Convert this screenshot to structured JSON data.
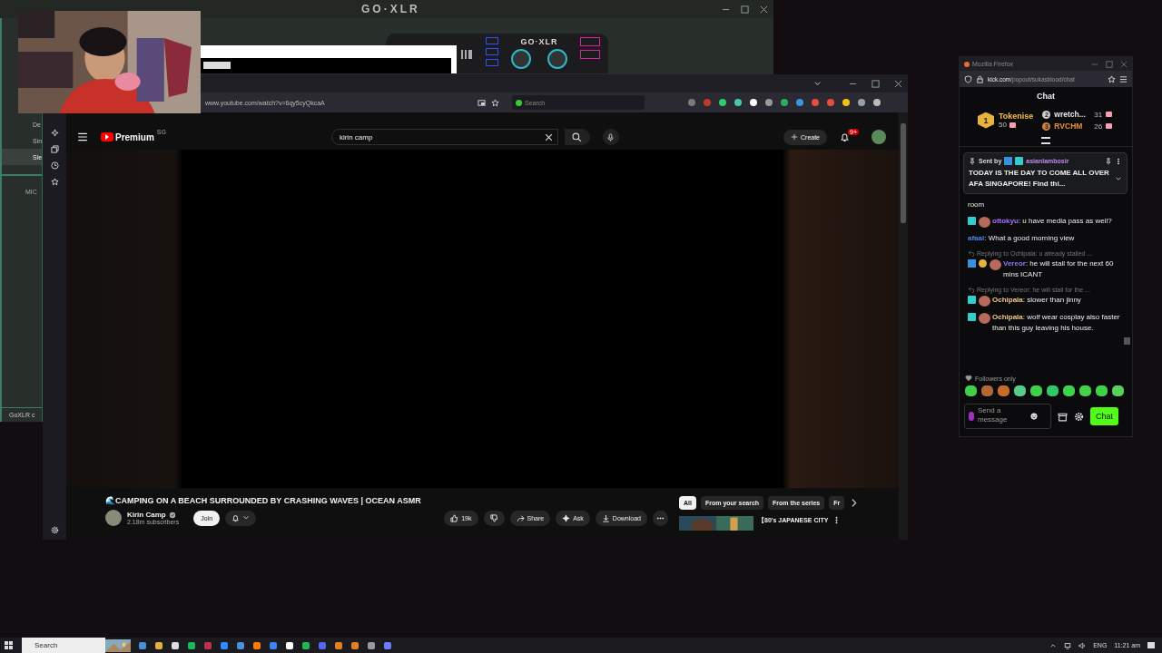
{
  "goxlr": {
    "title": "GO·XLR",
    "device_label": "GO·XLR",
    "sidebar": [
      {
        "label": "De",
        "selected": false
      },
      {
        "label": "Sin",
        "selected": false
      },
      {
        "label": "Sle",
        "selected": true
      }
    ],
    "section": "MIC",
    "status": "GoXLR c"
  },
  "youtube_window": {
    "url": "www.youtube.com/watch?v=6qy5cyQkcaA",
    "search_placeholder": "Search",
    "header": {
      "logo": "Premium",
      "logo_badge": "SG",
      "query": "kirin camp",
      "create": "Create",
      "notifications": "9+"
    },
    "video": {
      "title": "🌊CAMPING ON A BEACH SURROUNDED BY CRASHING WAVES | OCEAN ASMR",
      "channel": "Kirin Camp",
      "subscribers": "2.18m subscribers",
      "join": "Join",
      "likes": "19k",
      "actions": [
        {
          "kind": "share",
          "label": "Share"
        },
        {
          "kind": "ask",
          "label": "Ask"
        },
        {
          "kind": "download",
          "label": "Download"
        }
      ]
    },
    "chips": [
      {
        "label": "All",
        "selected": true
      },
      {
        "label": "From your search",
        "selected": false
      },
      {
        "label": "From the series",
        "selected": false
      },
      {
        "label": "Fr",
        "selected": false
      }
    ],
    "recommended": [
      {
        "title": "【80's JAPANESE CITY"
      }
    ]
  },
  "chat_window": {
    "title": "Mozilla Firefox",
    "url_host": "kick.com",
    "url_path": "/popout/sukasblood/chat",
    "heading": "Chat",
    "leaderboard": [
      {
        "rank": "1",
        "name": "Tokenise",
        "count": "50",
        "color": "#f5c044"
      },
      {
        "rank": "2",
        "name": "wretch...",
        "count": "31",
        "color": "#e8e8e8"
      },
      {
        "rank": "3",
        "name": "RVCHM",
        "count": "26",
        "color": "#e8913a"
      }
    ],
    "pinned": {
      "label": "Sent by",
      "user": "asianlambosir",
      "text": "TODAY IS THE DAY TO COME ALL OVER AFA SINGAPORE! Find thi..."
    },
    "messages": [
      {
        "kind": "text",
        "text": "room"
      },
      {
        "kind": "message",
        "badges": [
          {
            "kind": "og"
          },
          {
            "kind": "emote"
          }
        ],
        "user": "ottokyu",
        "color": "#a970ff",
        "text": ": u have media pass as well?"
      },
      {
        "kind": "message",
        "user": "afaai",
        "color": "#4a86e8",
        "text": ": What a good morning view"
      },
      {
        "kind": "message",
        "reply": "Replying to Ochipala: u already stalled ...",
        "badges": [
          {
            "kind": "hammer"
          },
          {
            "kind": "gift"
          },
          {
            "kind": "emote"
          }
        ],
        "user": "Vereor",
        "color": "#8b7cf0",
        "text": ": he will stall for the next 60 mins ICANT"
      },
      {
        "kind": "message",
        "reply": "Replying to Vereor: he will stall for the ...",
        "badges": [
          {
            "kind": "og"
          },
          {
            "kind": "emote"
          }
        ],
        "user": "Ochipala",
        "color": "#f0c890",
        "text": ": slower than jinny"
      },
      {
        "kind": "message",
        "badges": [
          {
            "kind": "og"
          },
          {
            "kind": "emote"
          }
        ],
        "user": "Ochipala",
        "color": "#f0c890",
        "text": ": wolf wear cosplay also faster than this guy leaving his house."
      }
    ],
    "mode": "Followers only",
    "placeholder": "Send a message",
    "send": "Chat"
  },
  "taskbar": {
    "search": "Search",
    "language": "ENG",
    "time": "11:21 am"
  }
}
